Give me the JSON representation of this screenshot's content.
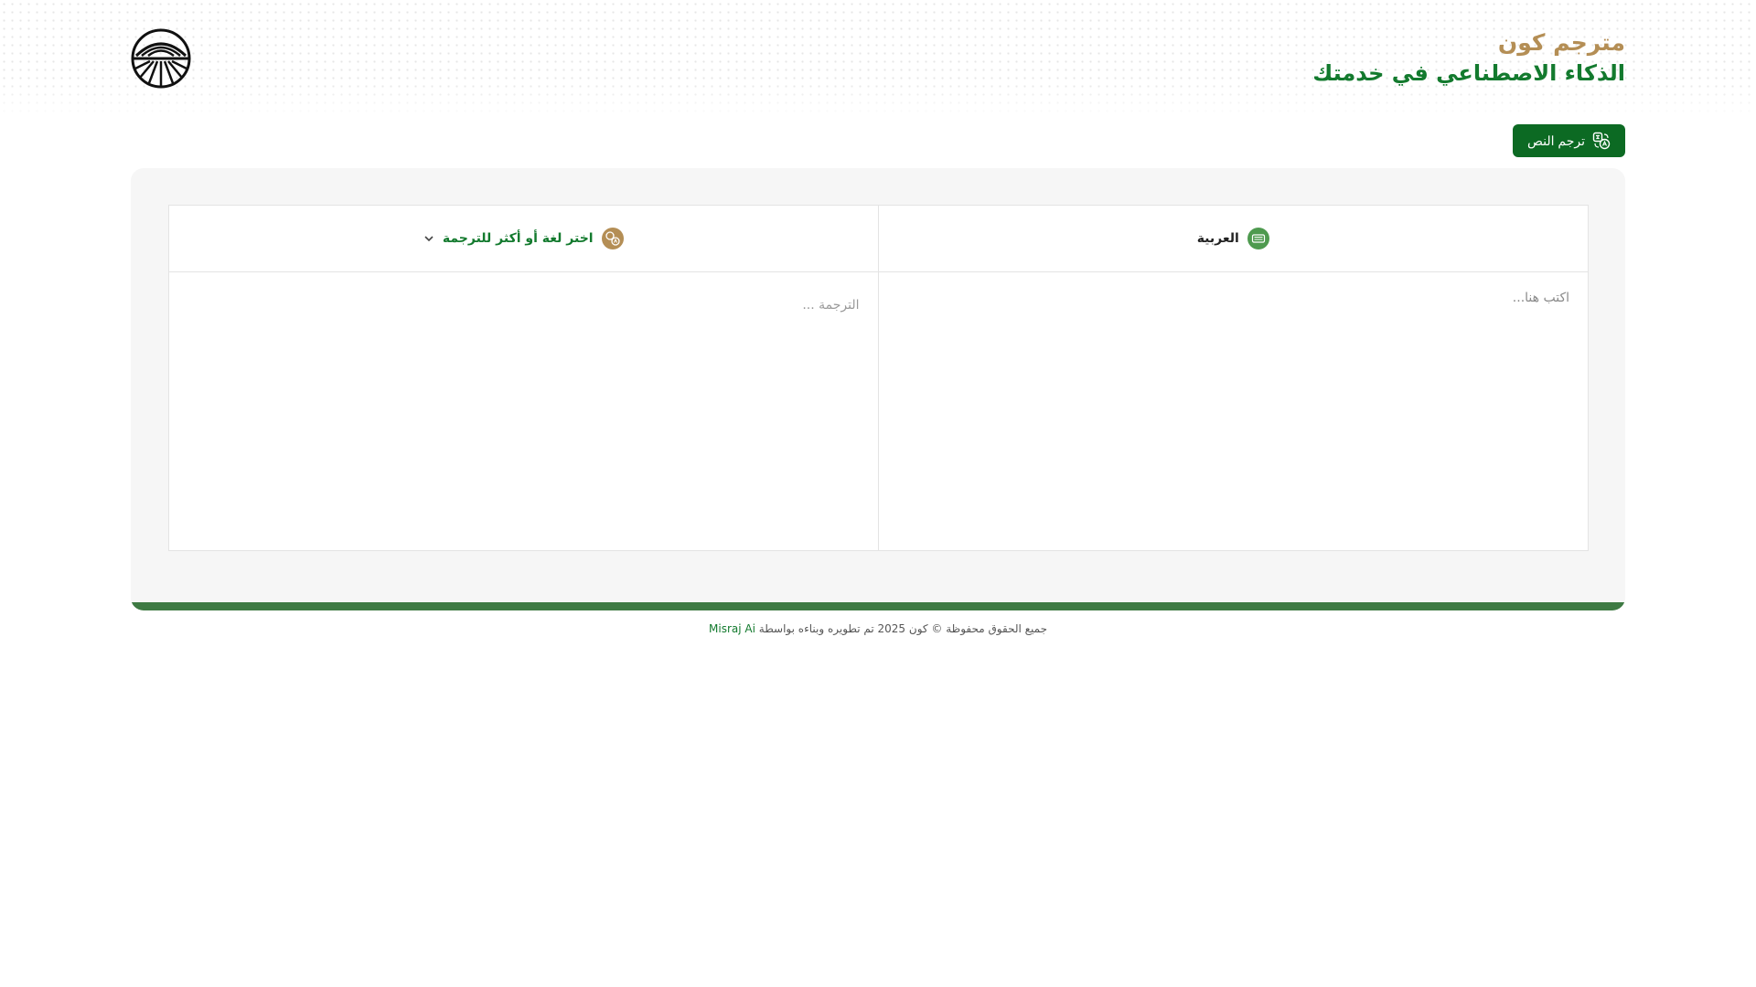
{
  "header": {
    "title_main": "مترجم كون",
    "title_sub": "الذكاء الاصطناعي في خدمتك",
    "logo_icon": "sun-horizon-logo-icon"
  },
  "toolbar": {
    "translate_label": "ترجم النص",
    "translate_icon": "translate-icon"
  },
  "source_panel": {
    "language": "العربية",
    "language_icon": "keyboard-badge-icon",
    "placeholder": "اكتب هنا...",
    "value": ""
  },
  "target_panel": {
    "language_prompt": "اختر لغة أو أكثر للترجمة",
    "language_icon": "language-globe-icon",
    "output_placeholder": "الترجمة ..."
  },
  "footer": {
    "text": "جميع الحقوق محفوظة © كون 2025 تم تطويره وبناءه بواسطة",
    "link_label": "Misraj Ai"
  },
  "colors": {
    "brand_green": "#0c6a23",
    "title_gold": "#b48e55",
    "title_green": "#137a2e",
    "bar_green": "#3e7a43"
  }
}
